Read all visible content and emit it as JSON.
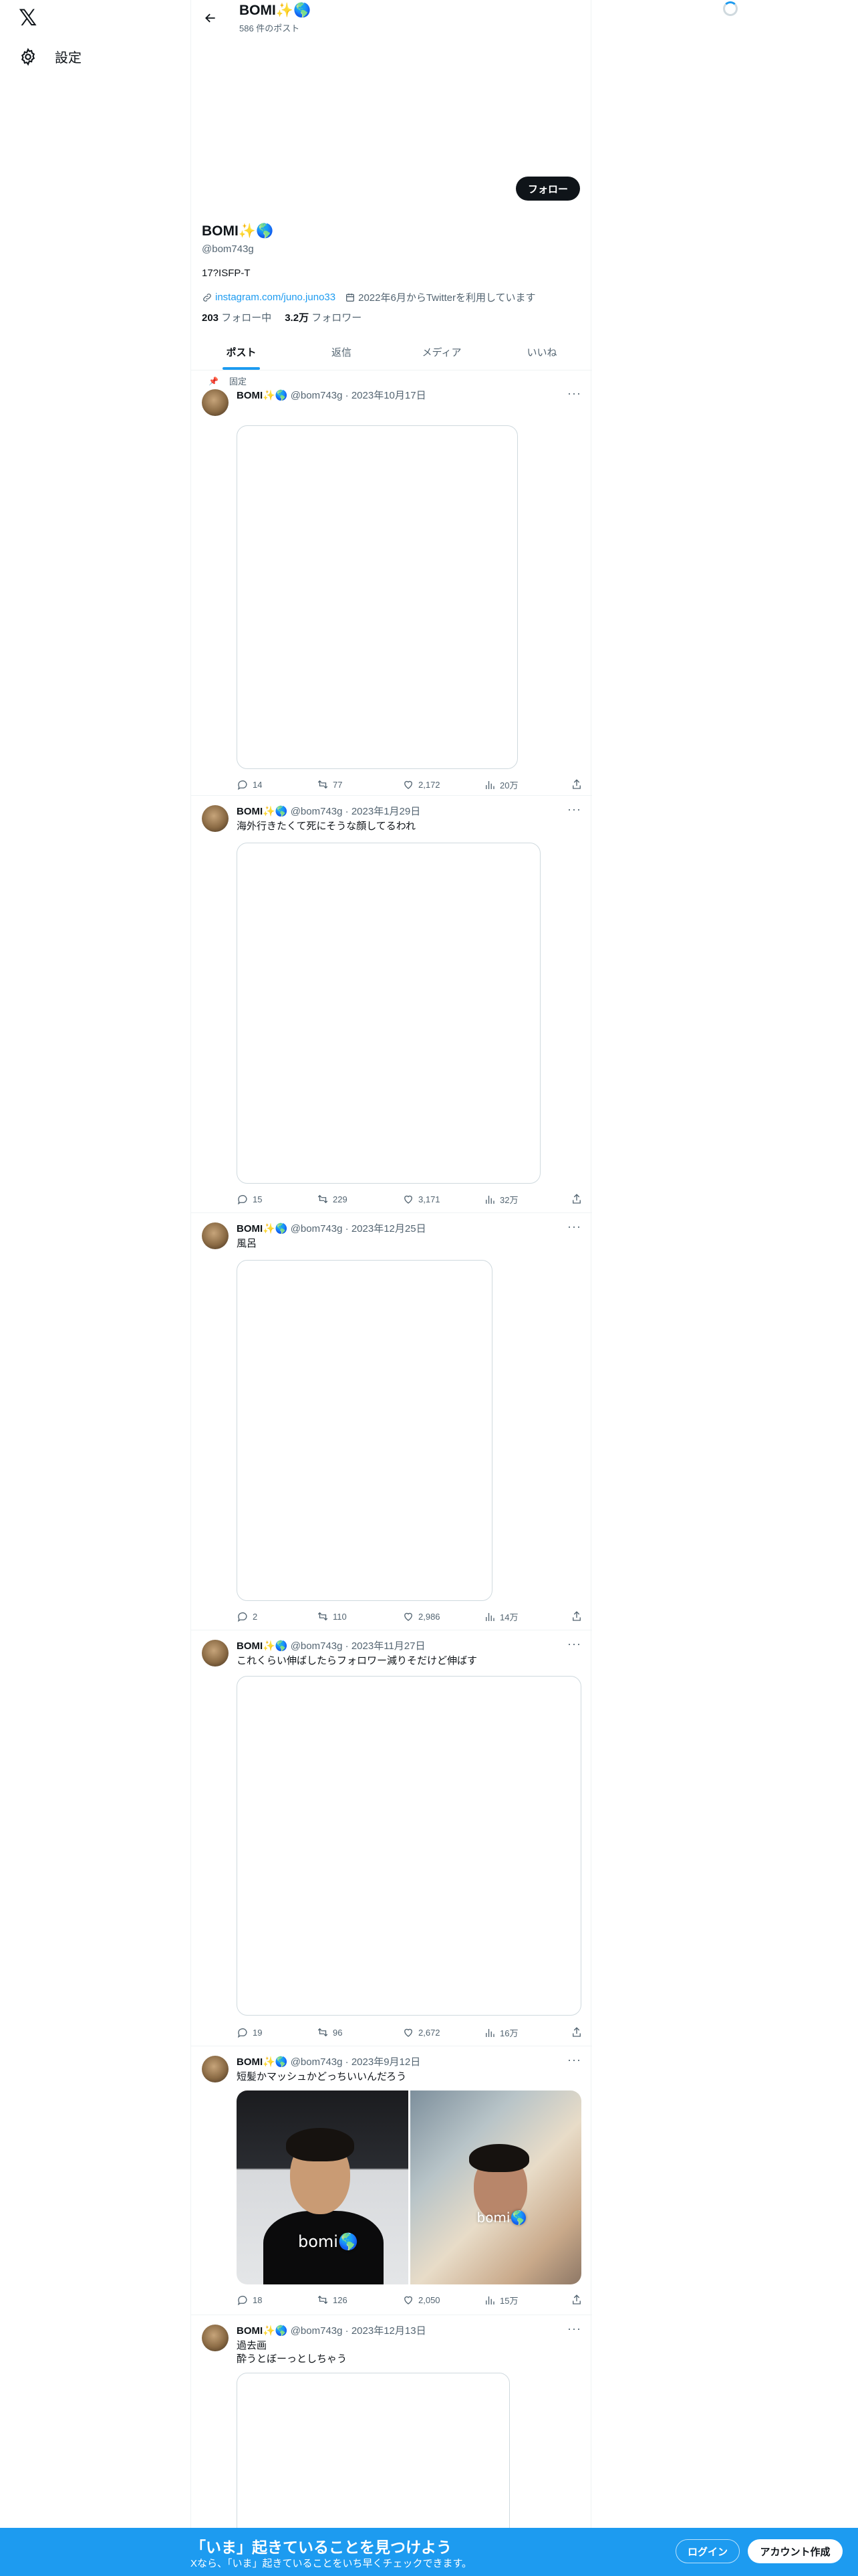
{
  "nav": {
    "logo": "𝕏",
    "settings_label": "設定",
    "settings_icon": "gear-icon"
  },
  "header": {
    "name": "BOMI✨🌎",
    "post_count": "586 件のポスト",
    "back_icon": "arrow-left-icon"
  },
  "profile": {
    "follow_label": "フォロー",
    "display_name": "BOMI✨🌎",
    "handle": "@bom743g",
    "bio": "17?ISFP-T",
    "link_text": "instagram.com/juno.juno33",
    "joined": "2022年6月からTwitterを利用しています",
    "following_count": "203",
    "following_label": "フォロー中",
    "followers_count": "3.2万",
    "followers_label": "フォロワー"
  },
  "tabs": [
    {
      "label": "ポスト",
      "active": true
    },
    {
      "label": "返信",
      "active": false
    },
    {
      "label": "メディア",
      "active": false
    },
    {
      "label": "いいね",
      "active": false
    }
  ],
  "tweets": [
    {
      "pinned_label": "固定",
      "name": "BOMI✨🌎",
      "handle": "@bom743g",
      "date": "2023年10月17日",
      "text": "",
      "replies": "14",
      "reposts": "77",
      "likes": "2,172",
      "views": "20万"
    },
    {
      "name": "BOMI✨🌎",
      "handle": "@bom743g",
      "date": "2023年1月29日",
      "text": "海外行きたくて死にそうな顔してるわれ",
      "replies": "15",
      "reposts": "229",
      "likes": "3,171",
      "views": "32万"
    },
    {
      "name": "BOMI✨🌎",
      "handle": "@bom743g",
      "date": "2023年12月25日",
      "text": "風呂",
      "replies": "2",
      "reposts": "110",
      "likes": "2,986",
      "views": "14万"
    },
    {
      "name": "BOMI✨🌎",
      "handle": "@bom743g",
      "date": "2023年11月27日",
      "text": "これくらい伸ばしたらフォロワー減りそだけど伸ばす",
      "replies": "19",
      "reposts": "96",
      "likes": "2,672",
      "views": "16万"
    },
    {
      "name": "BOMI✨🌎",
      "handle": "@bom743g",
      "date": "2023年9月12日",
      "text": "短髪かマッシュかどっちいいんだろう",
      "media_caption_left": "bomi🌎",
      "media_caption_right": "bomi🌎",
      "replies": "18",
      "reposts": "126",
      "likes": "2,050",
      "views": "15万"
    },
    {
      "name": "BOMI✨🌎",
      "handle": "@bom743g",
      "date": "2023年12月13日",
      "text": "過去画",
      "text2": "酔うとぼーっとしちゃう"
    }
  ],
  "banner": {
    "title": "「いま」起きていることを見つけよう",
    "subtitle": "Xなら、「いま」起きていることをいち早くチェックできます。",
    "login_label": "ログイン",
    "signup_label": "アカウント作成"
  },
  "colors": {
    "accent": "#1d9bf0",
    "text": "#0f1419",
    "secondary": "#536471"
  }
}
